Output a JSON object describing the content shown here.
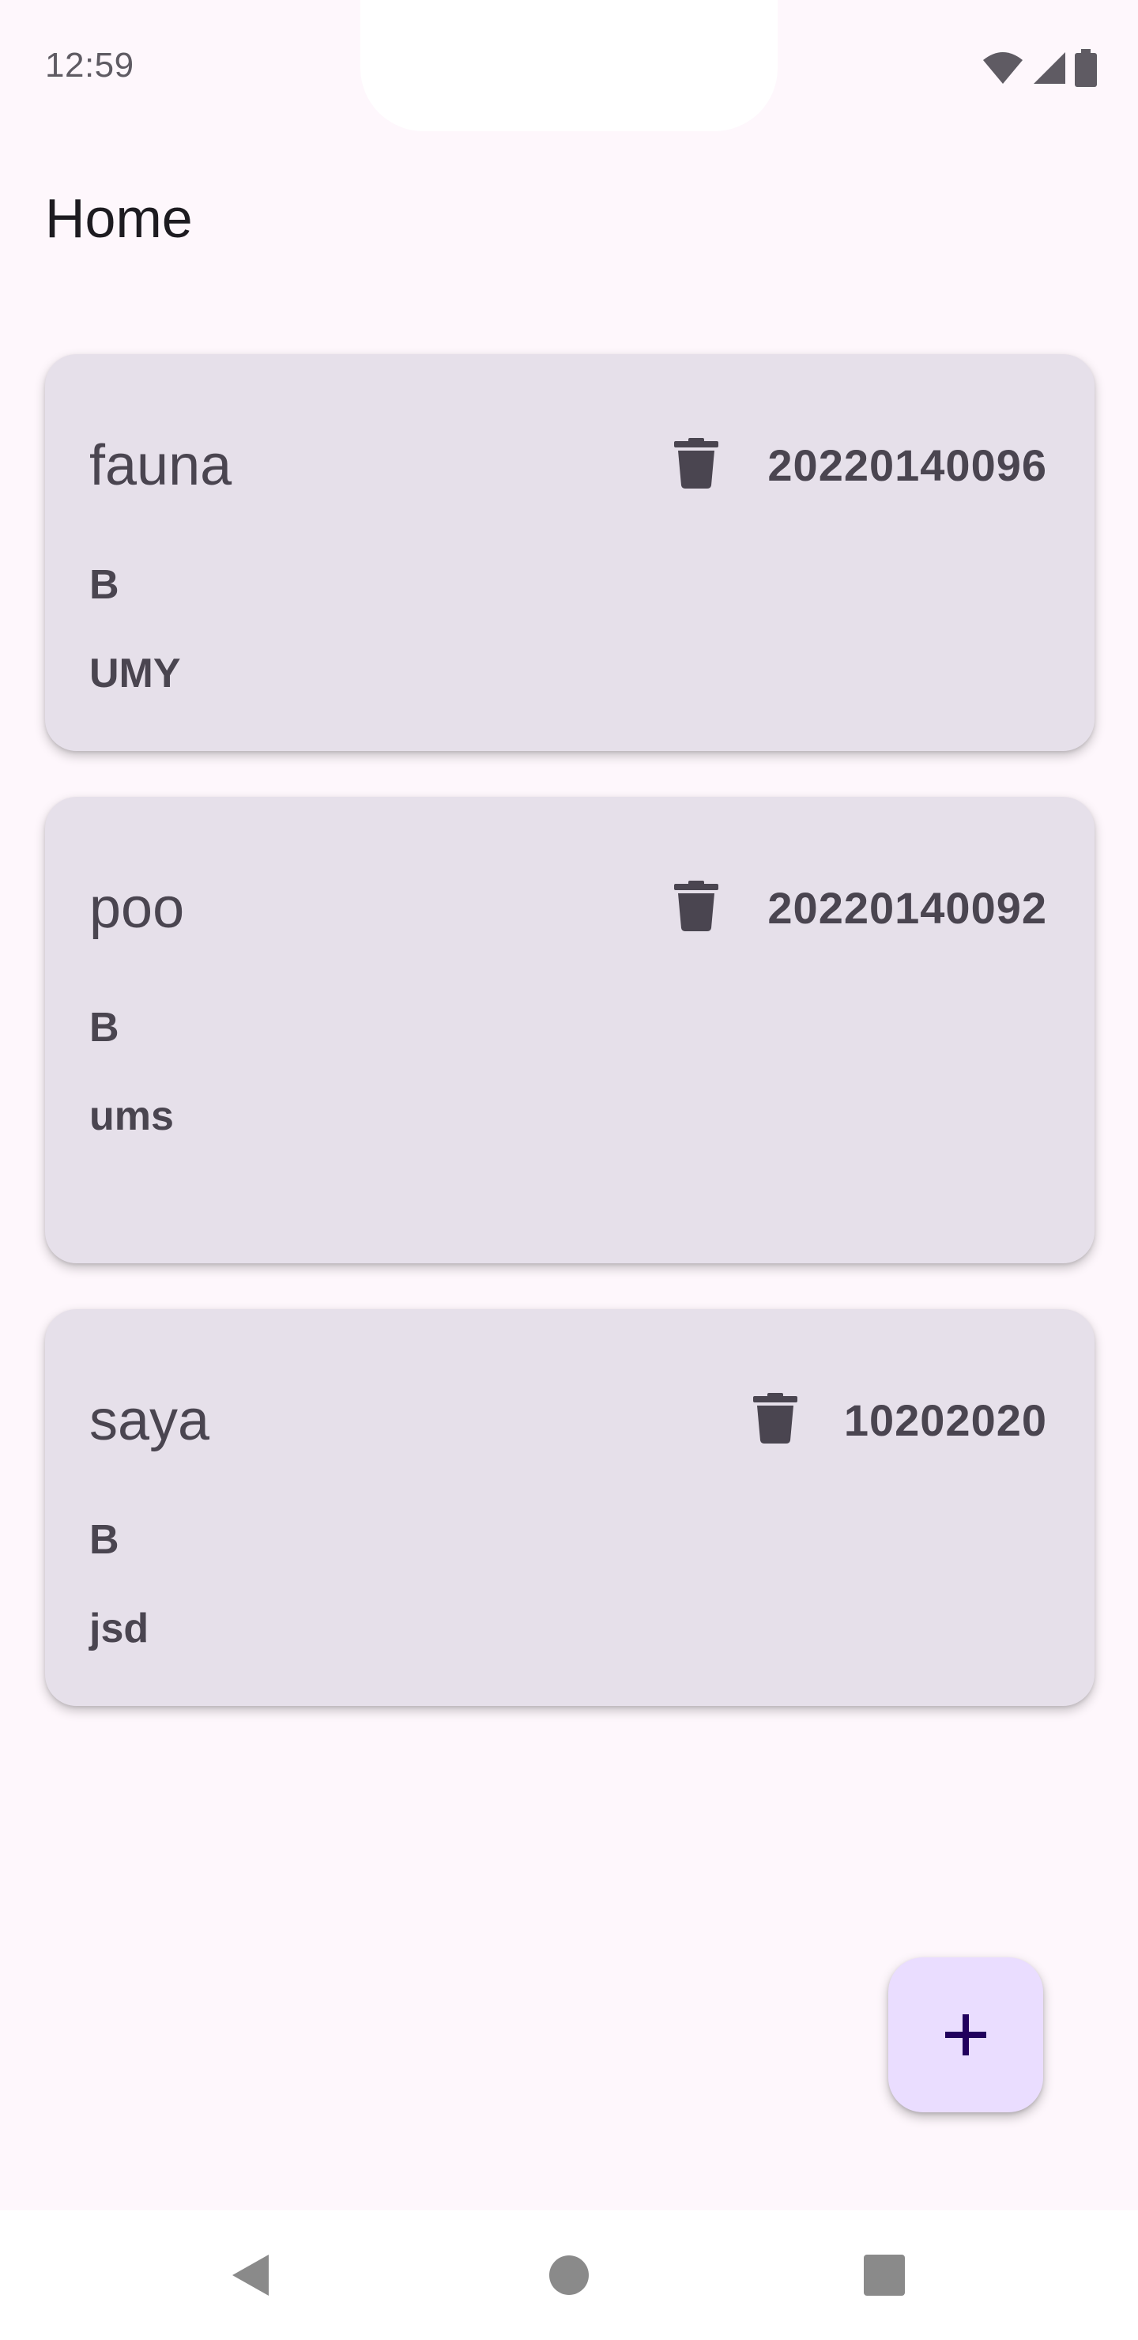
{
  "status_bar": {
    "time": "12:59",
    "icons": [
      "wifi-icon",
      "cellular-signal-icon",
      "battery-icon"
    ]
  },
  "app_bar": {
    "title": "Home"
  },
  "cards": [
    {
      "name": "fauna",
      "id": "20220140096",
      "line1": "B",
      "line2": "UMY"
    },
    {
      "name": "poo",
      "id": "20220140092",
      "line1": "B",
      "line2": "ums"
    },
    {
      "name": "saya",
      "id": "10202020",
      "line1": "B",
      "line2": "jsd"
    }
  ],
  "fab": {
    "icon": "plus-icon"
  },
  "navigation": {
    "buttons": [
      "back-icon",
      "home-icon",
      "recents-icon"
    ]
  },
  "colors": {
    "background": "#fef7fc",
    "card": "#e6e0ea",
    "card_text": "#4a4550",
    "fab_background": "#eaddff",
    "fab_icon": "#21005d",
    "nav_icon": "#8a8a8a"
  }
}
